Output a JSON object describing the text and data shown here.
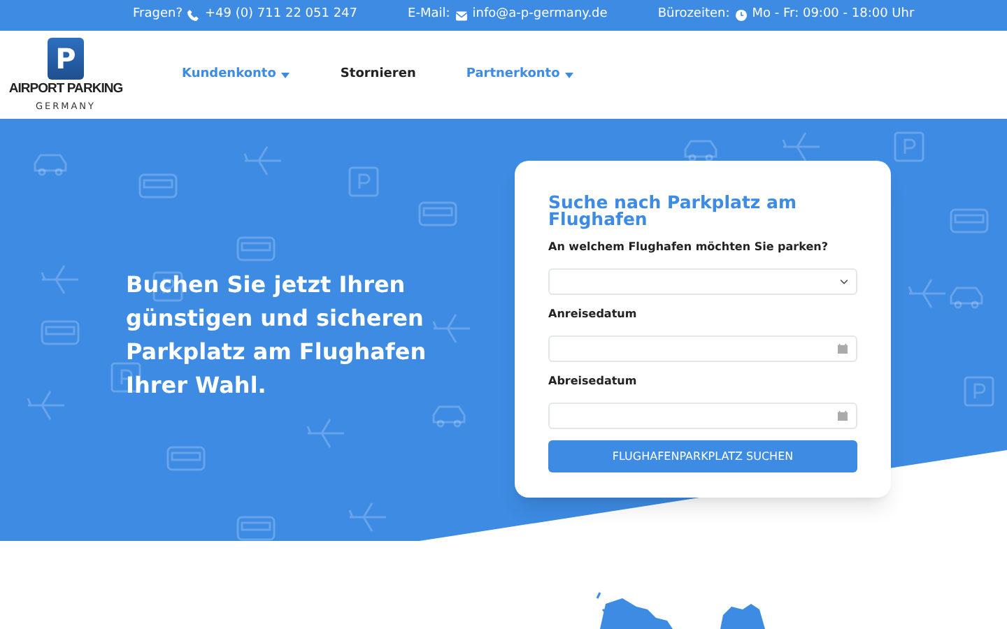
{
  "top_bar": {
    "phone_label": "Fragen?",
    "phone": "+49 (0) 711 22 051 247",
    "email_label": "E-Mail:",
    "email": "info@a-p-germany.de",
    "hours_label": "Bürozeiten:",
    "hours": "Mo - Fr: 09:00 - 18:00 Uhr"
  },
  "logo": {
    "letter": "P",
    "name": "AIRPORT PARKING",
    "country": "GERMANY"
  },
  "nav": [
    {
      "label": "Kundenkonto",
      "dropdown": true
    },
    {
      "label": "Stornieren",
      "dropdown": false
    },
    {
      "label": "Partnerkonto",
      "dropdown": true
    }
  ],
  "hero": {
    "headline": "Buchen Sie jetzt Ihren günstigen und sicheren Parkplatz am Flughafen Ihrer Wahl."
  },
  "search_form": {
    "title": "Suche nach Parkplatz am Flughafen",
    "fields": [
      {
        "label": "An welchem Flughafen möchten Sie parken?",
        "kind": "select"
      },
      {
        "label": "Anreisedatum",
        "kind": "date"
      },
      {
        "label": "Abreisedatum",
        "kind": "date"
      }
    ],
    "button": "FLUGHAFENPARKPLATZ SUCHEN"
  }
}
